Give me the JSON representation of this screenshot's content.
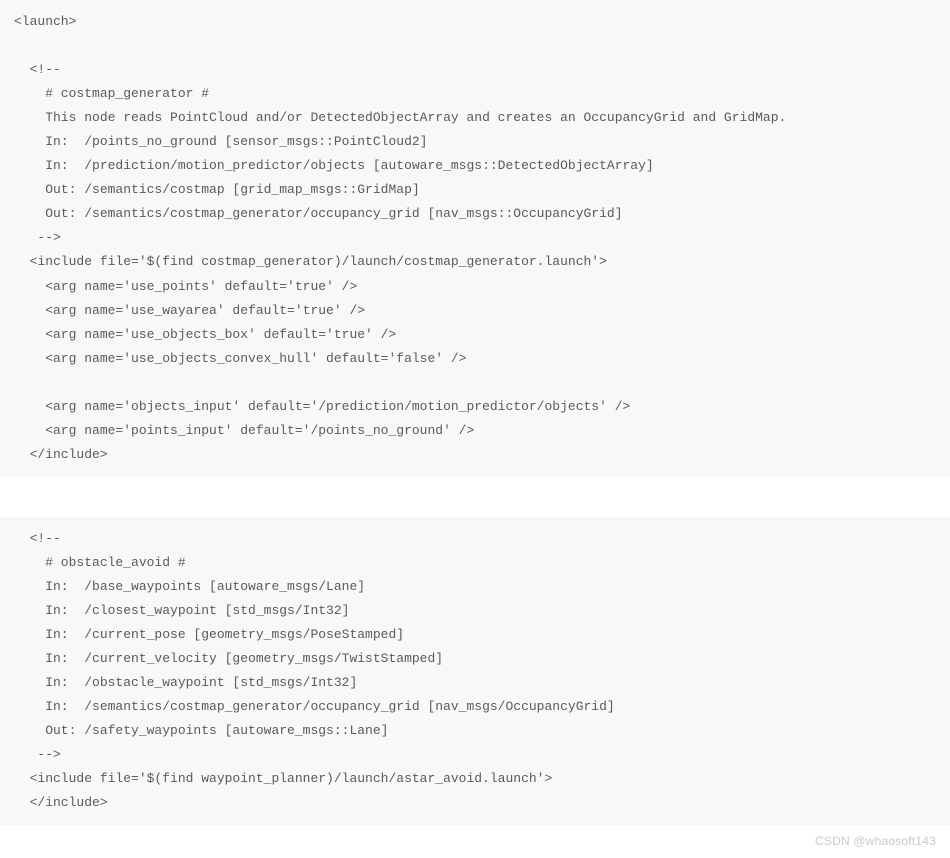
{
  "block1": {
    "l0": "<launch>",
    "l1": "",
    "l2": "  <!--",
    "l3": "    # costmap_generator #",
    "l4": "    This node reads PointCloud and/or DetectedObjectArray and creates an OccupancyGrid and GridMap.",
    "l5": "    In:  /points_no_ground [sensor_msgs::PointCloud2]",
    "l6": "    In:  /prediction/motion_predictor/objects [autoware_msgs::DetectedObjectArray]",
    "l7": "    Out: /semantics/costmap [grid_map_msgs::GridMap]",
    "l8": "    Out: /semantics/costmap_generator/occupancy_grid [nav_msgs::OccupancyGrid]",
    "l9": "   -->",
    "l10": "  <include file='$(find costmap_generator)/launch/costmap_generator.launch'>",
    "l11": "    <arg name='use_points' default='true' />",
    "l12": "    <arg name='use_wayarea' default='true' />",
    "l13": "    <arg name='use_objects_box' default='true' />",
    "l14": "    <arg name='use_objects_convex_hull' default='false' />",
    "l15": "",
    "l16": "    <arg name='objects_input' default='/prediction/motion_predictor/objects' />",
    "l17": "    <arg name='points_input' default='/points_no_ground' />",
    "l18": "  </include>"
  },
  "block2": {
    "l0": "  <!--",
    "l1": "    # obstacle_avoid #",
    "l2": "    In:  /base_waypoints [autoware_msgs/Lane]",
    "l3": "    In:  /closest_waypoint [std_msgs/Int32]",
    "l4": "    In:  /current_pose [geometry_msgs/PoseStamped]",
    "l5": "    In:  /current_velocity [geometry_msgs/TwistStamped]",
    "l6": "    In:  /obstacle_waypoint [std_msgs/Int32]",
    "l7": "    In:  /semantics/costmap_generator/occupancy_grid [nav_msgs/OccupancyGrid]",
    "l8": "    Out: /safety_waypoints [autoware_msgs::Lane]",
    "l9": "   -->",
    "l10": "  <include file='$(find waypoint_planner)/launch/astar_avoid.launch'>",
    "l11": "  </include>"
  },
  "watermark": "CSDN @whaosoft143"
}
